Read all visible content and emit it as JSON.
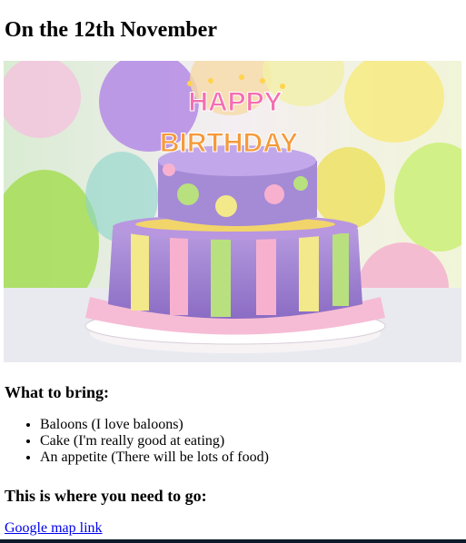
{
  "page": {
    "title": "On the 12th November",
    "cake_letters_row1": "HAPPY",
    "cake_letters_row2": "BIRTHDAY"
  },
  "bring": {
    "heading": "What to bring:",
    "items": [
      "Baloons (I love baloons)",
      "Cake (I'm really good at eating)",
      "An appetite (There will be lots of food)"
    ]
  },
  "location": {
    "heading": "This is where you need to go:",
    "link_text": "Google map link"
  },
  "colors": {
    "link": "#0000ee",
    "bottom_bar": "#0d1b2a"
  }
}
